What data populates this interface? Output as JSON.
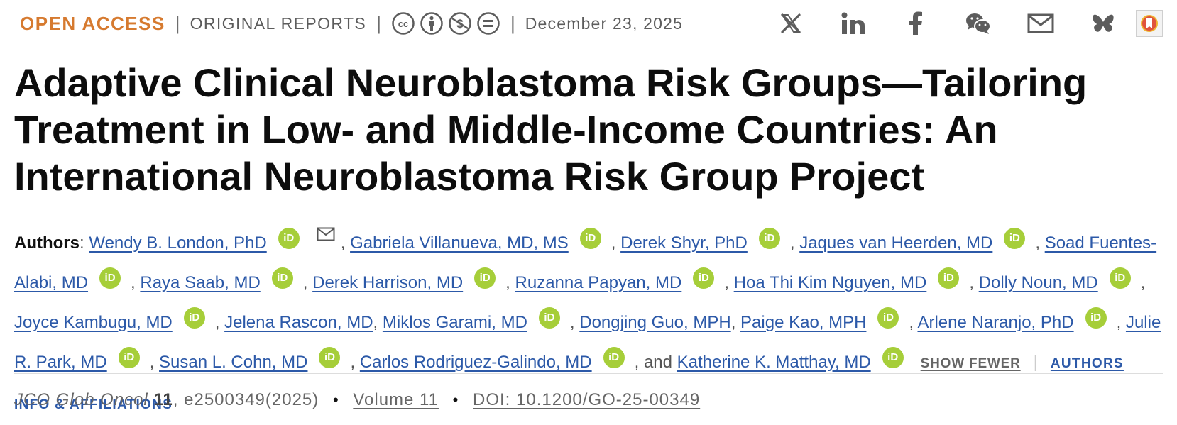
{
  "header": {
    "access_label": "OPEN ACCESS",
    "separator": "|",
    "article_type": "ORIGINAL REPORTS",
    "license_icons": [
      "cc-icon",
      "by-icon",
      "nc-icon",
      "nd-icon"
    ],
    "date": "December 23, 2025",
    "share_icons": [
      "x-icon",
      "linkedin-icon",
      "facebook-icon",
      "wechat-icon",
      "email-icon",
      "bluesky-icon",
      "bookmark-icon"
    ]
  },
  "article": {
    "title": "Adaptive Clinical Neuroblastoma Risk Groups—Tailoring Treatment in Low- and Middle-Income Countries: An International Neuroblastoma Risk Group Project"
  },
  "authors": {
    "label": "Authors",
    "label_colon": ": ",
    "orcid_text": "iD",
    "list": [
      {
        "name": "Wendy B. London, PhD",
        "orcid": true,
        "email": true,
        "sep": ", "
      },
      {
        "name": "Gabriela Villanueva, MD, MS",
        "orcid": true,
        "sep": ", "
      },
      {
        "name": "Derek Shyr, PhD",
        "orcid": true,
        "sep": ", "
      },
      {
        "name": "Jaques van Heerden, MD",
        "orcid": true,
        "sep": ", "
      },
      {
        "name": "Soad Fuentes-Alabi, MD",
        "orcid": true,
        "sep": ", "
      },
      {
        "name": "Raya Saab, MD",
        "orcid": true,
        "sep": ", "
      },
      {
        "name": "Derek Harrison, MD",
        "orcid": true,
        "sep": ", "
      },
      {
        "name": "Ruzanna Papyan, MD",
        "orcid": true,
        "sep": ", "
      },
      {
        "name": "Hoa Thi Kim Nguyen, MD",
        "orcid": true,
        "sep": ", "
      },
      {
        "name": "Dolly Noun, MD",
        "orcid": true,
        "sep": ", "
      },
      {
        "name": "Joyce Kambugu, MD",
        "orcid": true,
        "sep": ", "
      },
      {
        "name": "Jelena Rascon, MD",
        "orcid": false,
        "sep": ", "
      },
      {
        "name": "Miklos Garami, MD",
        "orcid": true,
        "sep": ", "
      },
      {
        "name": "Dongjing Guo, MPH",
        "orcid": false,
        "sep": ", "
      },
      {
        "name": "Paige Kao, MPH",
        "orcid": true,
        "sep": ", "
      },
      {
        "name": "Arlene Naranjo, PhD",
        "orcid": true,
        "sep": ", "
      },
      {
        "name": "Julie R. Park, MD",
        "orcid": true,
        "sep": ", "
      },
      {
        "name": "Susan L. Cohn, MD",
        "orcid": true,
        "sep": ", "
      },
      {
        "name": "Carlos Rodriguez-Galindo, MD",
        "orcid": true,
        "sep": ", and "
      },
      {
        "name": "Katherine K. Matthay, MD",
        "orcid": true,
        "sep": ""
      }
    ],
    "show_fewer": "SHOW FEWER",
    "divider": "|",
    "affiliations": "AUTHORS INFO & AFFILIATIONS"
  },
  "citation": {
    "journal": "JCO Glob Oncol",
    "volume_num": "11",
    "article_id": ", e2500349(2025)",
    "bullet": "•",
    "volume_link": "Volume 11",
    "doi": "DOI: 10.1200/GO-25-00349"
  },
  "colors": {
    "open_access": "#d67a2f",
    "link": "#2c59a8",
    "orcid": "#a6ce39",
    "muted": "#5c5c5c"
  }
}
